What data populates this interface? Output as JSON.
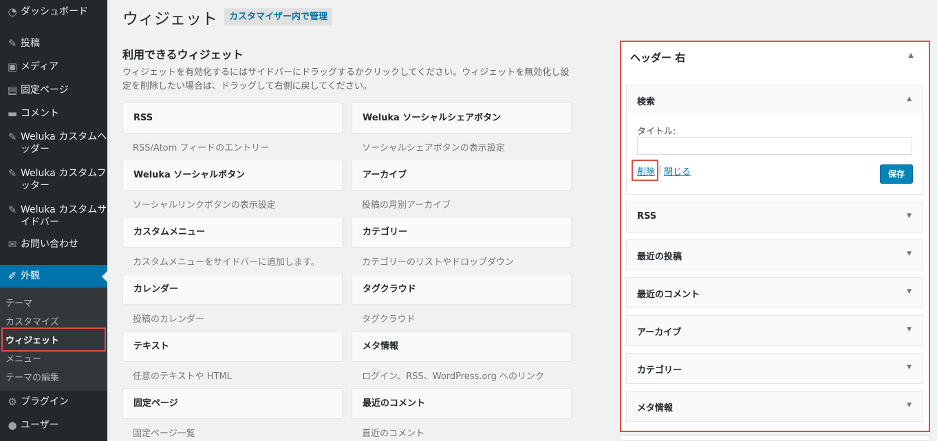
{
  "sidebar": {
    "items": [
      {
        "label": "ダッシュボード",
        "icon": "dashboard-icon",
        "glyph": "◔"
      },
      {
        "label": "投稿",
        "icon": "pin-icon",
        "glyph": "✎"
      },
      {
        "label": "メディア",
        "icon": "media-icon",
        "glyph": "▣"
      },
      {
        "label": "固定ページ",
        "icon": "page-icon",
        "glyph": "▤"
      },
      {
        "label": "コメント",
        "icon": "comment-icon",
        "glyph": "▬"
      },
      {
        "label": "Weluka カスタムヘッダー",
        "icon": "pin-icon",
        "glyph": "✎"
      },
      {
        "label": "Weluka カスタムフッター",
        "icon": "pin-icon",
        "glyph": "✎"
      },
      {
        "label": "Weluka カスタムサイドバー",
        "icon": "pin-icon",
        "glyph": "✎"
      },
      {
        "label": "お問い合わせ",
        "icon": "mail-icon",
        "glyph": "✉"
      },
      {
        "label": "外観",
        "icon": "brush-icon",
        "glyph": "✐"
      },
      {
        "label": "プラグイン",
        "icon": "plugin-icon",
        "glyph": "⚙"
      },
      {
        "label": "ユーザー",
        "icon": "user-icon",
        "glyph": "●"
      }
    ],
    "submenu": [
      "テーマ",
      "カスタマイズ",
      "ウィジェット",
      "メニュー",
      "テーマの編集"
    ]
  },
  "header": {
    "title": "ウィジェット",
    "customizer_button": "カスタマイザー内で管理"
  },
  "available": {
    "title": "利用できるウィジェット",
    "description": "ウィジェットを有効化するにはサイドバーにドラッグするかクリックしてください。ウィジェットを無効化し設定を削除したい場合は、ドラッグして右側に戻してください。",
    "widgets": [
      {
        "name": "RSS",
        "desc": "RSS/Atom フィードのエントリー"
      },
      {
        "name": "Weluka ソーシャルシェアボタン",
        "desc": "ソーシャルシェアボタンの表示設定"
      },
      {
        "name": "Weluka ソーシャルボタン",
        "desc": "ソーシャルリンクボタンの表示設定"
      },
      {
        "name": "アーカイブ",
        "desc": "投稿の月別アーカイブ"
      },
      {
        "name": "カスタムメニュー",
        "desc": "カスタムメニューをサイドバーに追加します。"
      },
      {
        "name": "カテゴリー",
        "desc": "カテゴリーのリストやドロップダウン"
      },
      {
        "name": "カレンダー",
        "desc": "投稿のカレンダー"
      },
      {
        "name": "タグクラウド",
        "desc": "タグクラウド"
      },
      {
        "name": "テキスト",
        "desc": "任意のテキストや HTML"
      },
      {
        "name": "メタ情報",
        "desc": "ログイン、RSS、WordPress.org へのリンク"
      },
      {
        "name": "固定ページ",
        "desc": "固定ページ一覧"
      },
      {
        "name": "最近のコメント",
        "desc": "直近のコメント"
      }
    ]
  },
  "area": {
    "title": "ヘッダー 右",
    "toggle": "▲",
    "open_widget": {
      "name": "検索",
      "arrow": "▲",
      "title_label": "タイトル:",
      "title_value": "",
      "delete": "削除",
      "separator": "|",
      "close": "閉じる",
      "save": "保存"
    },
    "widgets": [
      {
        "name": "RSS",
        "arrow": "▼"
      },
      {
        "name": "最近の投稿",
        "arrow": "▼"
      },
      {
        "name": "最近のコメント",
        "arrow": "▼"
      },
      {
        "name": "アーカイブ",
        "arrow": "▼"
      },
      {
        "name": "カテゴリー",
        "arrow": "▼"
      },
      {
        "name": "メタ情報",
        "arrow": "▼"
      }
    ]
  }
}
